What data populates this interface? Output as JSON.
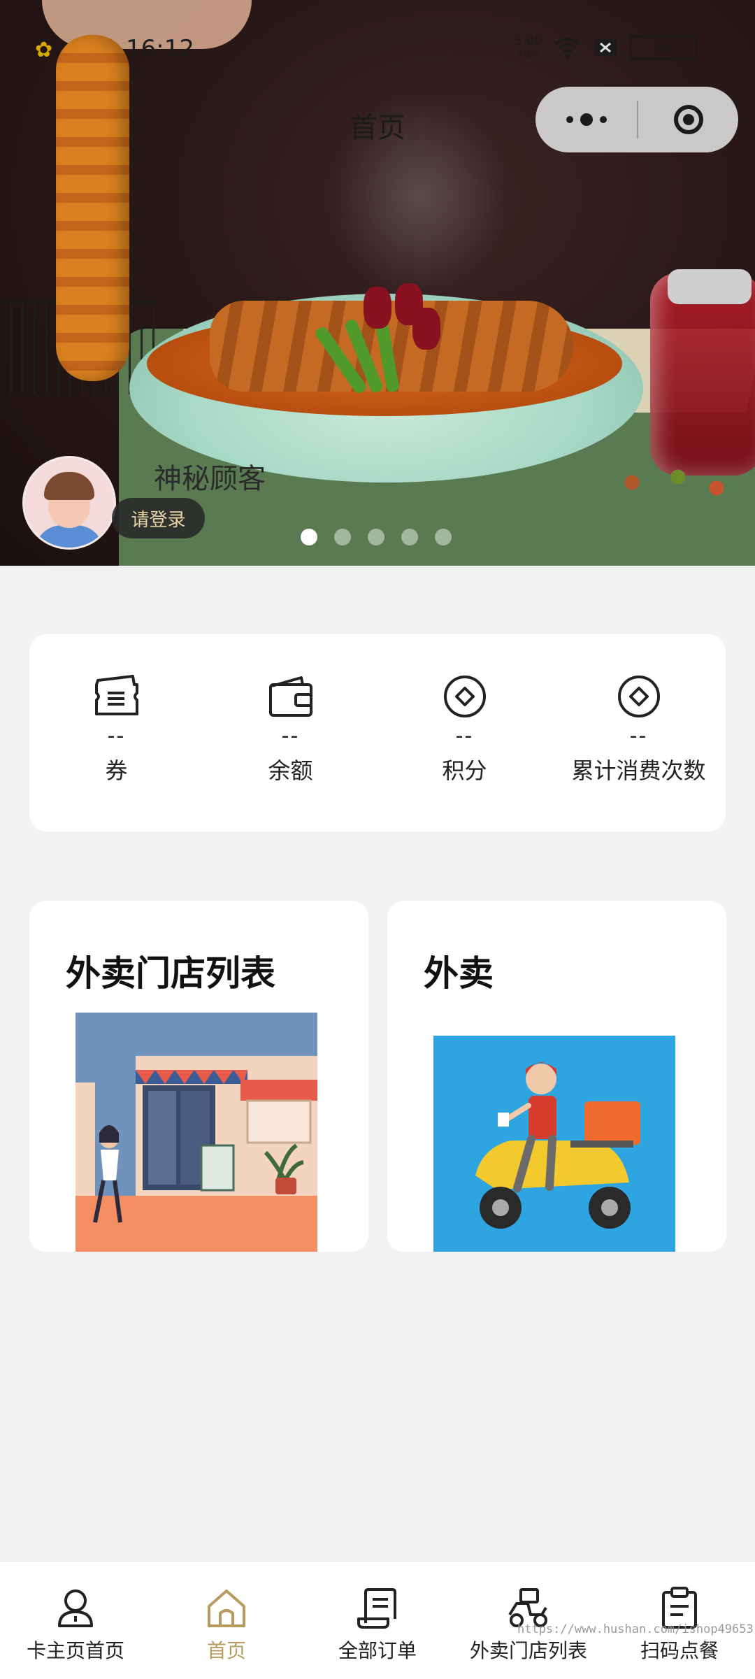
{
  "status_bar": {
    "time": "16:12",
    "net_speed": "5.00",
    "net_unit": "KB/S",
    "battery": "86"
  },
  "header": {
    "title": "首页"
  },
  "banner": {
    "slide_count": 5,
    "active_slide": 1
  },
  "profile": {
    "name": "神秘顾客",
    "login_label": "请登录"
  },
  "stats": [
    {
      "icon": "ticket-icon",
      "value": "--",
      "label": "券"
    },
    {
      "icon": "wallet-icon",
      "value": "--",
      "label": "余额"
    },
    {
      "icon": "points-icon",
      "value": "--",
      "label": "积分"
    },
    {
      "icon": "points-icon",
      "value": "--",
      "label": "累计消费次数"
    }
  ],
  "cards": [
    {
      "title": "外卖门店列表",
      "image": "storefront-illustration"
    },
    {
      "title": "外卖",
      "image": "delivery-scooter-illustration"
    }
  ],
  "tabbar": {
    "active_index": 1,
    "accent_color": "#b89b5e",
    "items": [
      {
        "label": "卡主页首页",
        "icon": "user-icon"
      },
      {
        "label": "首页",
        "icon": "home-icon"
      },
      {
        "label": "全部订单",
        "icon": "receipt-icon"
      },
      {
        "label": "外卖门店列表",
        "icon": "scooter-icon"
      },
      {
        "label": "扫码点餐",
        "icon": "clipboard-icon"
      }
    ]
  },
  "watermark": "https://www.hushan.com/ishop49653"
}
